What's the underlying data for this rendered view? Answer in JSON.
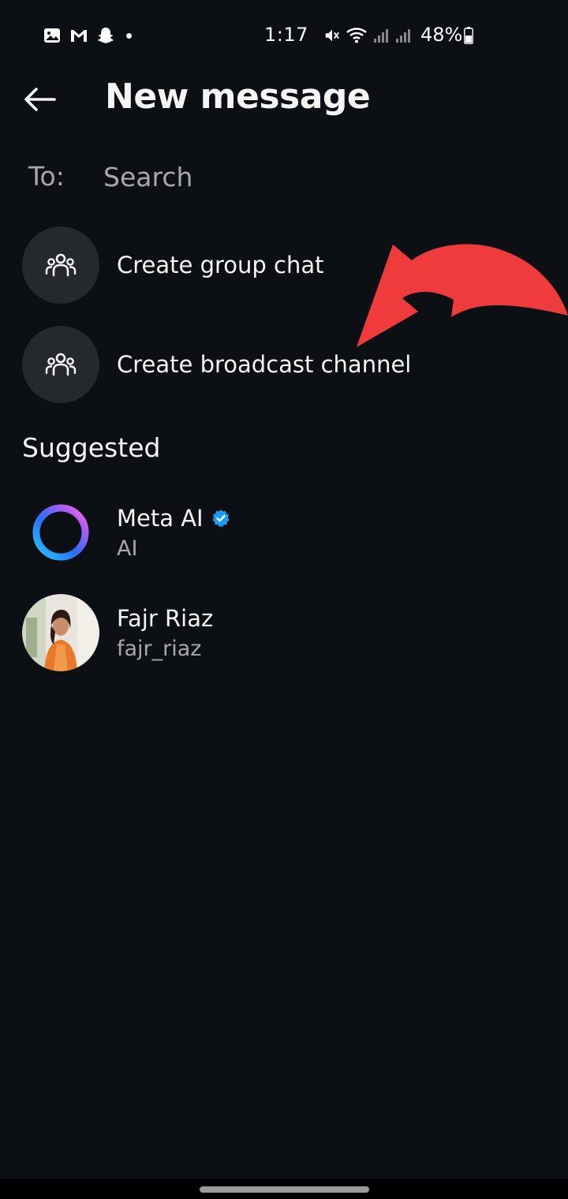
{
  "status_bar": {
    "time": "1:17",
    "battery": "48%",
    "left_icons": [
      "gallery-icon",
      "gmail-icon",
      "snapchat-icon",
      "notification-dot"
    ],
    "right_icons": [
      "mute-icon",
      "wifi-icon",
      "signal-icon",
      "signal-icon",
      "battery-icon"
    ]
  },
  "header": {
    "title": "New message",
    "back_icon": "back-arrow-icon"
  },
  "recipient": {
    "label": "To:",
    "placeholder": "Search"
  },
  "actions": [
    {
      "label": "Create group chat",
      "icon": "group-icon"
    },
    {
      "label": "Create broadcast channel",
      "icon": "group-icon"
    }
  ],
  "suggested": {
    "heading": "Suggested",
    "items": [
      {
        "name": "Meta AI",
        "subtitle": "AI",
        "verified": true,
        "avatar": "meta-ai-ring"
      },
      {
        "name": "Fajr Riaz",
        "subtitle": "fajr_riaz",
        "verified": false,
        "avatar": "photo"
      }
    ]
  },
  "colors": {
    "background": "#0c1014",
    "icon_circle": "#25292e",
    "text_primary": "#f5f5f5",
    "text_secondary": "#a8a8a8",
    "verified_blue": "#1d9bf0",
    "annotation_red": "#ef3b3b"
  }
}
